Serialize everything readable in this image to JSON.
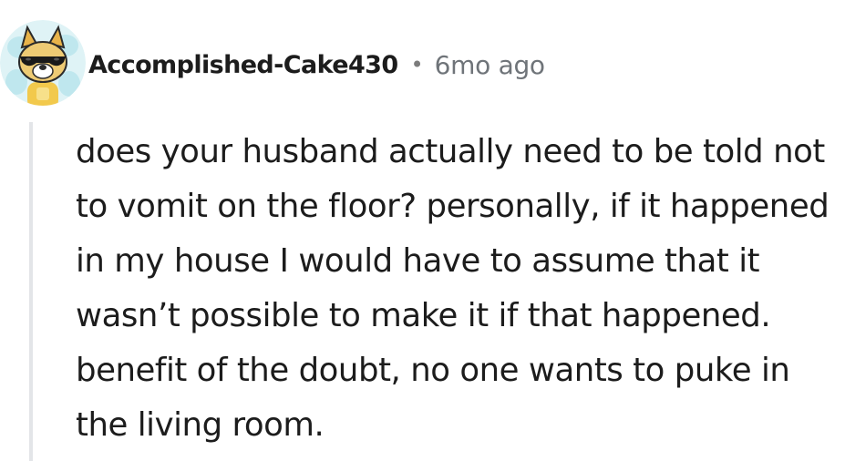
{
  "comment": {
    "author": "Accomplished-Cake430",
    "separator": "•",
    "timestamp": "6mo ago",
    "avatar_icon": "cartoon-dog-with-sunglasses-avatar",
    "body": "does your husband actually need to be told not to vomit on the floor? personally, if it happened in my house I would have to assume that it wasn’t possible to make it if that happened. benefit of the doubt, no one wants to puke in the living room."
  },
  "colors": {
    "text": "#1c1c1c",
    "meta": "#6f7479",
    "thread_line": "#e3e5e8",
    "avatar_bg": "#dff3f6",
    "avatar_fur": "#e8c66a"
  }
}
